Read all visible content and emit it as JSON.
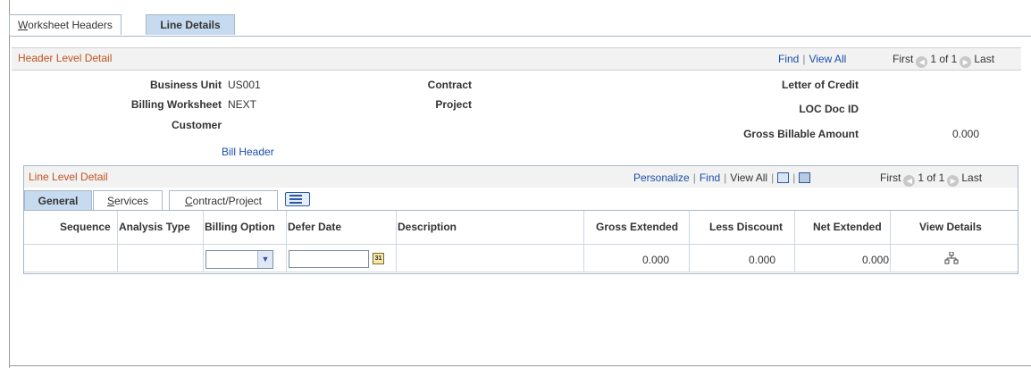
{
  "tabs": {
    "worksheet_headers_ul": "W",
    "worksheet_headers_rest": "orksheet Headers",
    "line_details": "Line Details"
  },
  "header": {
    "title": "Header Level Detail",
    "find": "Find",
    "view_all": "View All",
    "first": "First",
    "count": "1 of 1",
    "last": "Last",
    "sep": "|"
  },
  "fields": {
    "business_unit_label": "Business Unit",
    "business_unit_value": "US001",
    "billing_worksheet_label": "Billing Worksheet",
    "billing_worksheet_value": "NEXT",
    "customer_label": "Customer",
    "contract_label": "Contract",
    "project_label": "Project",
    "loc_label": "Letter of Credit",
    "loc_doc_label": "LOC Doc ID",
    "gross_billable_label": "Gross Billable Amount",
    "gross_billable_value": "0.000",
    "bill_header_link": "Bill Header"
  },
  "line": {
    "title": "Line Level Detail",
    "personalize": "Personalize",
    "find": "Find",
    "view_all": "View All",
    "first": "First",
    "count": "1 of 1",
    "last": "Last",
    "sep": "|",
    "tabs": {
      "general": "General",
      "services_ul": "S",
      "services_rest": "ervices",
      "contract_ul": "C",
      "contract_rest": "ontract/Project"
    },
    "columns": {
      "sequence": "Sequence",
      "analysis_type": "Analysis Type",
      "billing_option": "Billing Option",
      "defer_date": "Defer Date",
      "description": "Description",
      "gross_extended": "Gross Extended",
      "less_discount": "Less Discount",
      "net_extended": "Net Extended",
      "view_details": "View Details"
    },
    "row": {
      "gross_extended": "0.000",
      "less_discount": "0.000",
      "net_extended": "0.000",
      "calendar_text": "31"
    }
  },
  "icons": {
    "prev": "◀",
    "next": "▶",
    "dropdown": "▼"
  }
}
